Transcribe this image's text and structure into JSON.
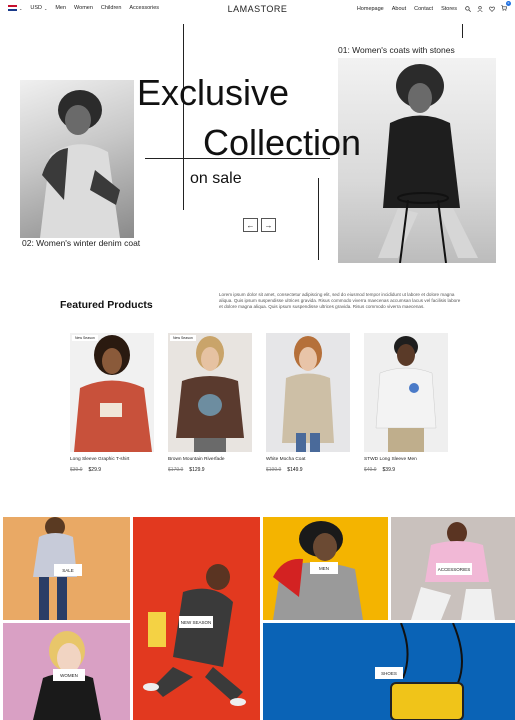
{
  "nav": {
    "currency": "USD",
    "links": [
      "Men",
      "Women",
      "Children",
      "Accessories"
    ],
    "brand": "LAMASTORE",
    "right_links": [
      "Homepage",
      "About",
      "Contact",
      "Stores"
    ],
    "cart_count": "0"
  },
  "hero": {
    "title_line1": "Exclusive",
    "title_line2": "Collection",
    "subtitle": "on sale",
    "caption_right": "01: Women's coats with stones",
    "caption_left": "02: Women's winter denim coat",
    "prev_arrow": "←",
    "next_arrow": "→"
  },
  "featured": {
    "title": "Featured Products",
    "description": "Lorem ipsum dolor sit amet, consectetur adipiscing elit, sed do eiusmod tempor incididunt ut labore et dolore magna aliqua. Quis ipsum suspendisse ultrices gravida. Risus commodo viverra maecenas accumsan lacus vel facilisis labore et dolore magna aliqua. Quis ipsum suspendisse ultrices gravida. Risus commodo viverra maecenas.",
    "products": [
      {
        "badge": "New Season",
        "name": "Long Sleeve Graphic T-shirt",
        "old_price": "$39.9",
        "price": "$29.9"
      },
      {
        "badge": "New Season",
        "name": "Brown Mountain Riverfade",
        "old_price": "$179.9",
        "price": "$129.9"
      },
      {
        "badge": "",
        "name": "White Mocha Coat",
        "old_price": "$199.9",
        "price": "$149.9"
      },
      {
        "badge": "",
        "name": "STWD Long Sleeve Men",
        "old_price": "$49.9",
        "price": "$39.9"
      }
    ]
  },
  "categories": {
    "sale": "Sale",
    "women": "Women",
    "new_season": "New Season",
    "men": "Men",
    "accessories": "Accessories",
    "shoes": "Shoes"
  },
  "colors": {
    "cat_sale": "#e9a965",
    "cat_women": "#d9a0c4",
    "cat_new_season": "#e2391f",
    "cat_men": "#f4b400",
    "cat_accessories": "#c9c1bd",
    "cat_shoes": "#0a63b6",
    "cart_badge": "#1f6fe0"
  }
}
